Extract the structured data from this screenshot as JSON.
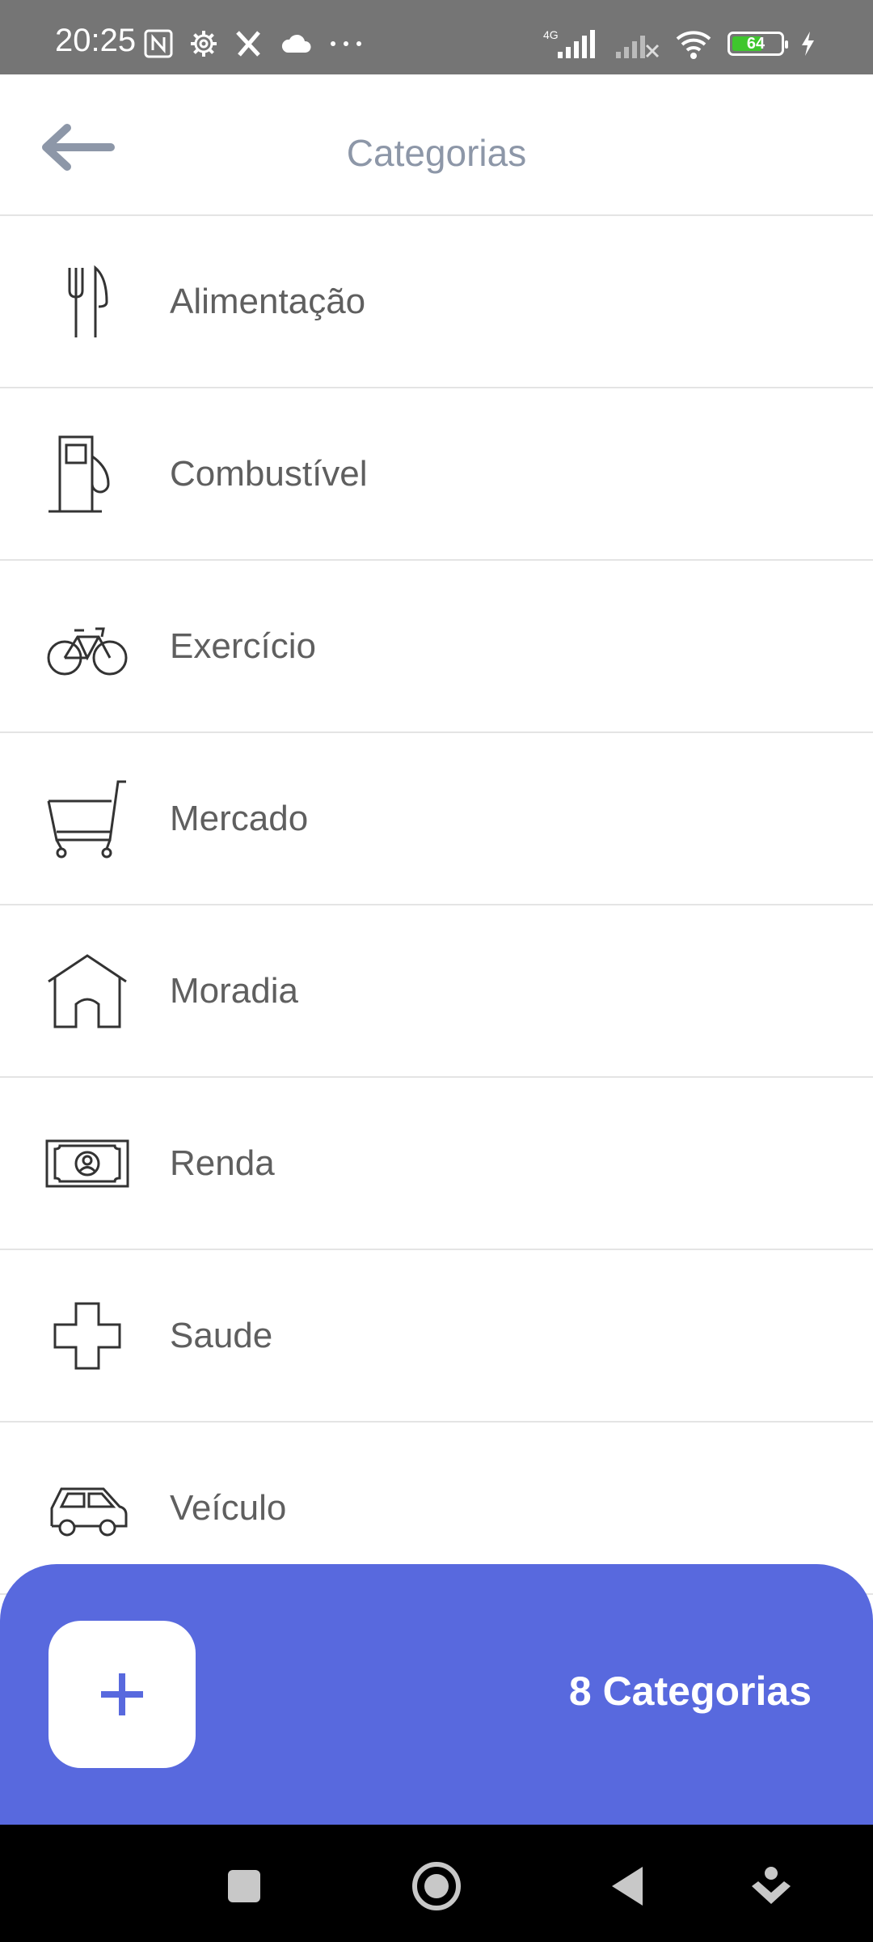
{
  "status_bar": {
    "time": "20:25",
    "network": "4G",
    "battery": "64",
    "battery_level": 0.64
  },
  "header": {
    "title": "Categorias"
  },
  "categories": [
    {
      "label": "Alimentação",
      "icon": "fork-knife-icon"
    },
    {
      "label": "Combustível",
      "icon": "fuel-pump-icon"
    },
    {
      "label": "Exercício",
      "icon": "bicycle-icon"
    },
    {
      "label": "Mercado",
      "icon": "shopping-cart-icon"
    },
    {
      "label": "Moradia",
      "icon": "house-icon"
    },
    {
      "label": "Renda",
      "icon": "banknote-icon"
    },
    {
      "label": "Saude",
      "icon": "medical-cross-icon"
    },
    {
      "label": "Veículo",
      "icon": "car-icon"
    }
  ],
  "footer": {
    "count_text": "8 Categorias",
    "accent_color": "#5869de"
  }
}
